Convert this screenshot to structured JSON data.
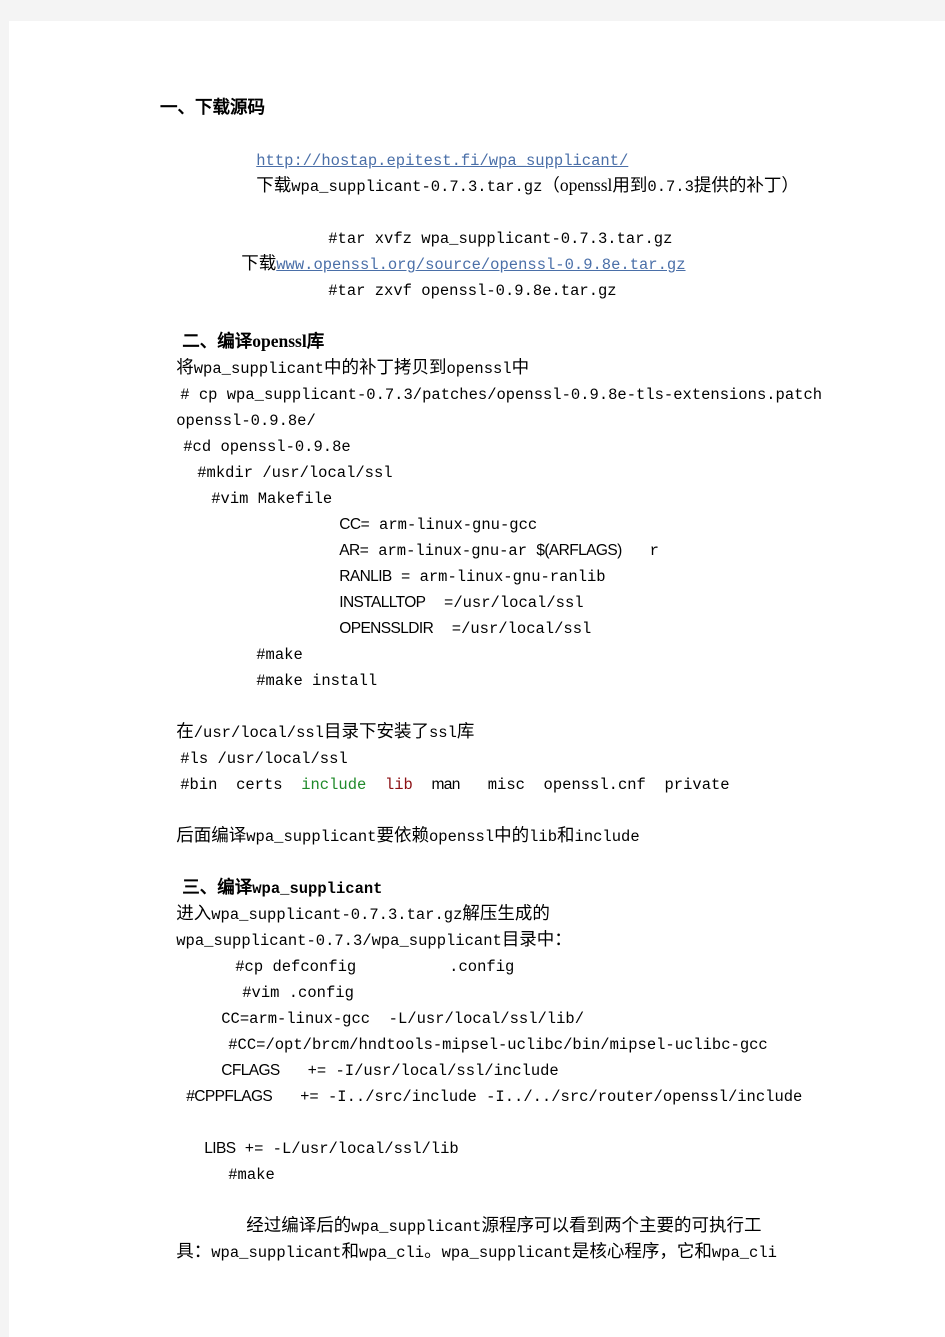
{
  "page": {
    "background_color": "#f4f4f4",
    "paper_color": "#ffffff"
  },
  "colors": {
    "link": "#4a6fa8",
    "green": "#1f8a2a",
    "dark_red": "#8c1014",
    "text": "#000000"
  },
  "sections": [
    {
      "heading": "一、下载源码",
      "lines": [
        {
          "id": "l1",
          "text": "http://hostap.epitest.fi/wpa_supplicant/"
        },
        {
          "id": "l2a",
          "text": "下载"
        },
        {
          "id": "l2b",
          "text": "wpa_supplicant-0.7.3.tar.gz"
        },
        {
          "id": "l2c",
          "text": "（openssl"
        },
        {
          "id": "l2d",
          "text": "用到"
        },
        {
          "id": "l2e",
          "text": "0.7.3"
        },
        {
          "id": "l2f",
          "text": "提供的补丁）"
        },
        {
          "id": "l3",
          "text": "#tar xvfz wpa_supplicant-0.7.3.tar.gz"
        },
        {
          "id": "l4a",
          "text": "下载"
        },
        {
          "id": "l4b",
          "text": "www.openssl.org/source/openssl-0.9.8e.tar.gz"
        },
        {
          "id": "l5",
          "text": "#tar zxvf openssl-0.9.8e.tar.gz"
        }
      ]
    },
    {
      "heading_prefix": "二、编译",
      "heading_mid": "openssl",
      "heading_suffix": "库",
      "lines": [
        {
          "id": "s2l1a",
          "text": "将"
        },
        {
          "id": "s2l1b",
          "text": "wpa_supplicant"
        },
        {
          "id": "s2l1c",
          "text": "中的补丁拷贝到"
        },
        {
          "id": "s2l1d",
          "text": "openssl"
        },
        {
          "id": "s2l1e",
          "text": "中"
        },
        {
          "id": "s2l2",
          "text": "# cp wpa_supplicant-0.7.3/patches/openssl-0.9.8e-tls-extensions.patch"
        },
        {
          "id": "s2l3",
          "text": "openssl-0.9.8e/"
        },
        {
          "id": "s2l4",
          "text": "#cd openssl-0.9.8e"
        },
        {
          "id": "s2l5",
          "text": "#mkdir /usr/local/ssl"
        },
        {
          "id": "s2l6",
          "text": "#vim Makefile"
        },
        {
          "id": "mk1k",
          "text": "CC"
        },
        {
          "id": "mk1v",
          "text": "= arm-linux-gnu-gcc"
        },
        {
          "id": "mk2k",
          "text": "AR"
        },
        {
          "id": "mk2v",
          "text": "= arm-linux-gnu-ar"
        },
        {
          "id": "mk2p",
          "text": "$(ARFLAGS)"
        },
        {
          "id": "mk2r",
          "text": "r"
        },
        {
          "id": "mk3k",
          "text": "RANLIB"
        },
        {
          "id": "mk3v",
          "text": "= arm-linux-gnu-ranlib"
        },
        {
          "id": "mk4k",
          "text": "INSTALLTOP"
        },
        {
          "id": "mk4v",
          "text": "=/usr/local/ssl"
        },
        {
          "id": "mk5k",
          "text": "OPENSSLDIR"
        },
        {
          "id": "mk5v",
          "text": "=/usr/local/ssl"
        },
        {
          "id": "s2l7",
          "text": "#make"
        },
        {
          "id": "s2l8",
          "text": "#make install"
        },
        {
          "id": "s2l9a",
          "text": "在"
        },
        {
          "id": "s2l9b",
          "text": "/usr/local/ssl"
        },
        {
          "id": "s2l9c",
          "text": "目录下安装了"
        },
        {
          "id": "s2l9d",
          "text": "ssl"
        },
        {
          "id": "s2l9e",
          "text": "库"
        },
        {
          "id": "s2l10",
          "text": "#ls /usr/local/ssl"
        },
        {
          "id": "ls1",
          "text": "#bin"
        },
        {
          "id": "ls2",
          "text": "certs"
        },
        {
          "id": "ls3",
          "text": "include"
        },
        {
          "id": "ls4",
          "text": "lib"
        },
        {
          "id": "ls5",
          "text": "man"
        },
        {
          "id": "ls6",
          "text": "misc"
        },
        {
          "id": "ls7",
          "text": "openssl.cnf"
        },
        {
          "id": "ls8",
          "text": "private"
        },
        {
          "id": "s2l11a",
          "text": "后面编译"
        },
        {
          "id": "s2l11b",
          "text": "wpa_supplicant"
        },
        {
          "id": "s2l11c",
          "text": "要依赖"
        },
        {
          "id": "s2l11d",
          "text": "openssl"
        },
        {
          "id": "s2l11e",
          "text": "中的"
        },
        {
          "id": "s2l11f",
          "text": "lib"
        },
        {
          "id": "s2l11g",
          "text": "和"
        },
        {
          "id": "s2l11h",
          "text": "include"
        }
      ]
    },
    {
      "heading_prefix": "三、编译",
      "heading_mid": "wpa_supplicant",
      "lines": [
        {
          "id": "s3l1a",
          "text": "进入"
        },
        {
          "id": "s3l1b",
          "text": "wpa_supplicant-0.7.3.tar.gz"
        },
        {
          "id": "s3l1c",
          "text": "解压生成的"
        },
        {
          "id": "s3l2a",
          "text": "wpa_supplicant-0.7.3/wpa_supplicant"
        },
        {
          "id": "s3l2b",
          "text": "目录中："
        },
        {
          "id": "s3l3",
          "text": "#cp defconfig          .config"
        },
        {
          "id": "s3l4",
          "text": "#vim .config"
        },
        {
          "id": "s3l5",
          "text": "CC=arm-linux-gcc  -L/usr/local/ssl/lib/"
        },
        {
          "id": "s3l6",
          "text": "#CC=/opt/brcm/hndtools-mipsel-uclibc/bin/mipsel-uclibc-gcc"
        },
        {
          "id": "s3l7k",
          "text": "CFLAGS"
        },
        {
          "id": "s3l7v",
          "text": "+= -I/usr/local/ssl/include"
        },
        {
          "id": "s3l8k",
          "text": "#CPPFLAGS"
        },
        {
          "id": "s3l8v",
          "text": "+= -I../src/include -I../../src/router/openssl/include"
        },
        {
          "id": "s3l9k",
          "text": "LIBS"
        },
        {
          "id": "s3l9v",
          "text": "+= -L/usr/local/ssl/lib"
        },
        {
          "id": "s3l10",
          "text": "#make"
        },
        {
          "id": "s3p1a",
          "text": "经过编译后的"
        },
        {
          "id": "s3p1b",
          "text": "wpa_supplicant"
        },
        {
          "id": "s3p1c",
          "text": "源程序可以看到两个主要的可执行工"
        },
        {
          "id": "s3p2a",
          "text": "具："
        },
        {
          "id": "s3p2b",
          "text": "wpa_supplicant"
        },
        {
          "id": "s3p2c",
          "text": "和"
        },
        {
          "id": "s3p2d",
          "text": "wpa_cli"
        },
        {
          "id": "s3p2e",
          "text": "。"
        },
        {
          "id": "s3p2f",
          "text": "wpa_supplicant"
        },
        {
          "id": "s3p2g",
          "text": "是核心程序，它和"
        },
        {
          "id": "s3p2h",
          "text": "wpa_cli"
        }
      ]
    }
  ]
}
